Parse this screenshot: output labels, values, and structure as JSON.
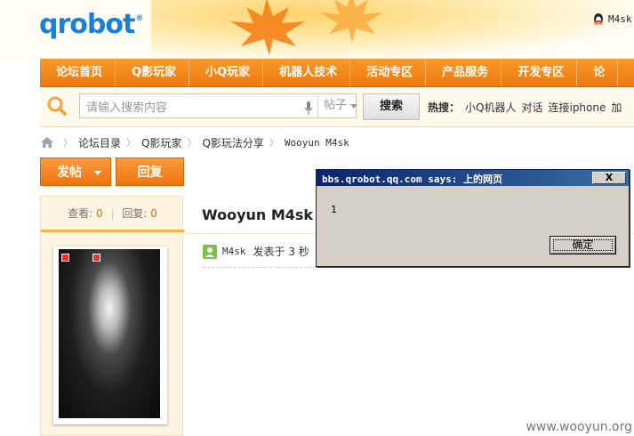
{
  "header": {
    "logo_text": "qrobot",
    "logo_mark": "®",
    "user_name": "M4sk"
  },
  "nav": {
    "items": [
      "论坛首页",
      "Q影玩家",
      "小Q玩家",
      "机器人技术",
      "活动专区",
      "产品服务",
      "开发专区",
      "论"
    ]
  },
  "search": {
    "placeholder": "请输入搜索内容",
    "scope": "帖子",
    "button": "搜索",
    "hot_label": "热搜：",
    "hot_items": [
      "小Q机器人",
      "对话",
      "连接iphone",
      "加"
    ]
  },
  "breadcrumb": [
    "论坛目录",
    "Q影玩家",
    "Q影玩法分享",
    "Wooyun M4sk"
  ],
  "actions": {
    "post": "发帖",
    "reply": "回复"
  },
  "stats": {
    "views_label": "查看:",
    "views": "0",
    "replies_label": "回复:",
    "replies": "0"
  },
  "post": {
    "title": "Wooyun M4sk",
    "author": "M4sk",
    "meta": "发表于 3 秒"
  },
  "dialog": {
    "title": "bbs.qrobot.qq.com says: 上的网页",
    "close": "X",
    "message": "1",
    "ok": "确定"
  },
  "watermark": "www.wooyun.org",
  "colors": {
    "brand_blue": "#1c7fd6",
    "nav_orange": "#f08418",
    "accent_orange": "#e06c00",
    "dialog_title": "#0a246a"
  }
}
